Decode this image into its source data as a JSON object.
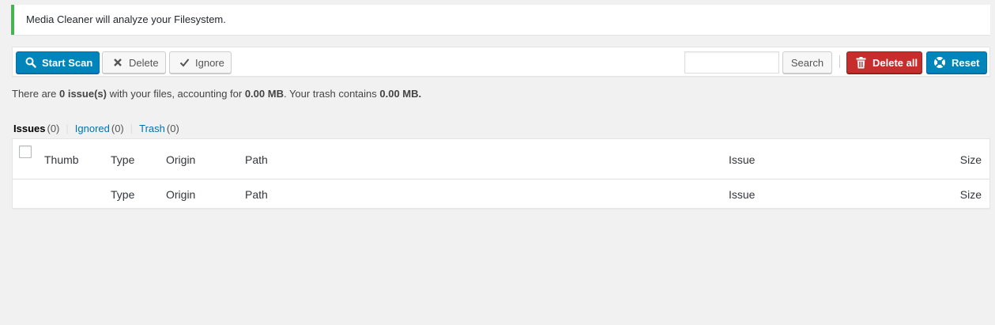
{
  "notice": {
    "text": "Media Cleaner will analyze your Filesystem."
  },
  "toolbar": {
    "start_scan": "Start Scan",
    "delete": "Delete",
    "ignore": "Ignore",
    "search_value": "",
    "search_button": "Search",
    "delete_all": "Delete all",
    "reset": "Reset"
  },
  "summary": {
    "prefix": "There are ",
    "issues": "0 issue(s)",
    "middle": " with your files, accounting for ",
    "size": "0.00 MB",
    "trash_text": ". Your trash contains ",
    "trash_size": "0.00 MB."
  },
  "filters": {
    "issues_label": "Issues",
    "issues_count": "(0)",
    "sep": "|",
    "ignored_label": "Ignored",
    "ignored_count": "(0)",
    "trash_label": "Trash",
    "trash_count": "(0)"
  },
  "table": {
    "header": {
      "thumb": "Thumb",
      "type": "Type",
      "origin": "Origin",
      "path": "Path",
      "issue": "Issue",
      "size": "Size"
    },
    "footer": {
      "type": "Type",
      "origin": "Origin",
      "path": "Path",
      "issue": "Issue",
      "size": "Size"
    }
  },
  "colors": {
    "notice_border": "#46b450",
    "primary": "#0085ba",
    "danger": "#c62d2d",
    "link": "#0073aa"
  },
  "icons": {
    "start_scan": "search-icon",
    "delete": "x-icon",
    "ignore": "check-icon",
    "delete_all": "trash-icon",
    "reset": "lifebuoy-icon"
  }
}
